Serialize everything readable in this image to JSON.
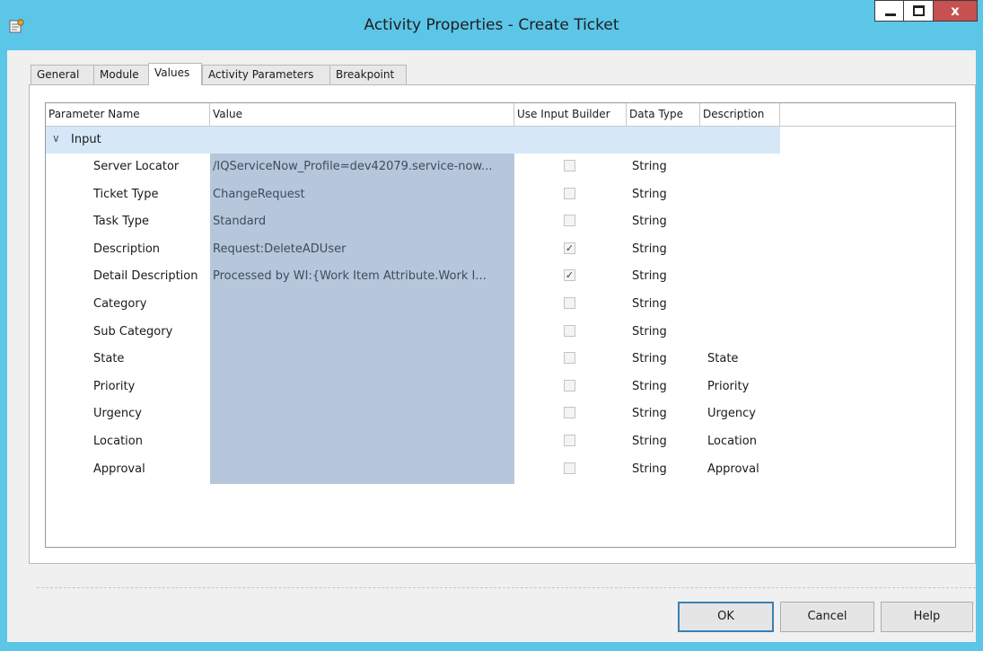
{
  "window": {
    "title": "Activity Properties - Create Ticket",
    "close_label": "x"
  },
  "tabs": [
    {
      "label": "General"
    },
    {
      "label": "Module"
    },
    {
      "label": "Values"
    },
    {
      "label": "Activity Parameters"
    },
    {
      "label": "Breakpoint"
    }
  ],
  "active_tab": "Values",
  "grid": {
    "columns": [
      "Parameter Name",
      "Value",
      "Use Input Builder",
      "Data Type",
      "Description"
    ],
    "group": {
      "label": "Input",
      "chevron": "∨"
    },
    "rows": [
      {
        "name": "Server Locator",
        "value": "/IQServiceNow_Profile=dev42079.service-now...",
        "use_input_builder": false,
        "type": "String",
        "description": ""
      },
      {
        "name": "Ticket Type",
        "value": "ChangeRequest",
        "use_input_builder": false,
        "type": "String",
        "description": ""
      },
      {
        "name": "Task Type",
        "value": "Standard",
        "use_input_builder": false,
        "type": "String",
        "description": ""
      },
      {
        "name": "Description",
        "value": "Request:DeleteADUser",
        "use_input_builder": true,
        "type": "String",
        "description": ""
      },
      {
        "name": "Detail Description",
        "value": "Processed  by WI:{Work Item Attribute.Work I...",
        "use_input_builder": true,
        "type": "String",
        "description": ""
      },
      {
        "name": "Category",
        "value": "",
        "use_input_builder": false,
        "type": "String",
        "description": ""
      },
      {
        "name": "Sub Category",
        "value": "",
        "use_input_builder": false,
        "type": "String",
        "description": ""
      },
      {
        "name": "State",
        "value": "",
        "use_input_builder": false,
        "type": "String",
        "description": "State"
      },
      {
        "name": "Priority",
        "value": "",
        "use_input_builder": false,
        "type": "String",
        "description": "Priority"
      },
      {
        "name": "Urgency",
        "value": "",
        "use_input_builder": false,
        "type": "String",
        "description": "Urgency"
      },
      {
        "name": "Location",
        "value": "",
        "use_input_builder": false,
        "type": "String",
        "description": "Location"
      },
      {
        "name": "Approval",
        "value": "",
        "use_input_builder": false,
        "type": "String",
        "description": "Approval"
      }
    ]
  },
  "buttons": {
    "ok": "OK",
    "cancel": "Cancel",
    "help": "Help"
  }
}
